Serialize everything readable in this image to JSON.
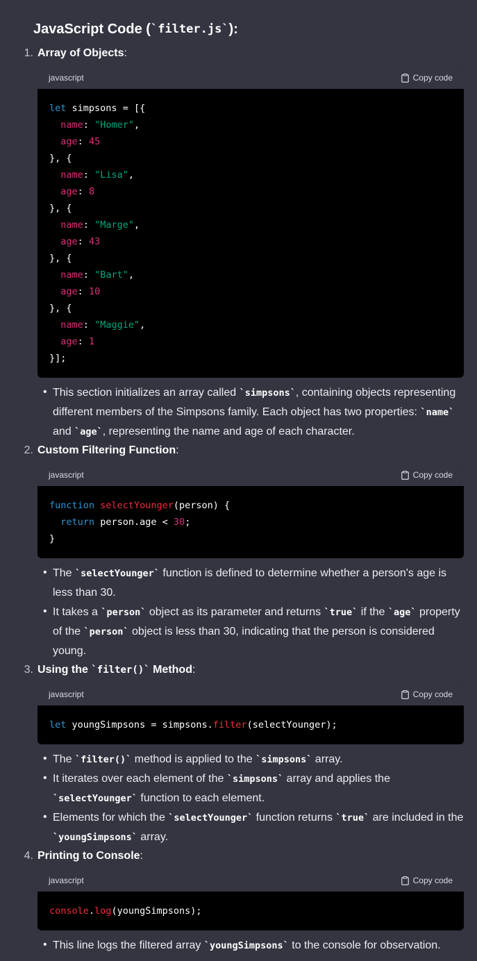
{
  "heading": {
    "prefix": "JavaScript Code (",
    "code": "`filter.js`",
    "suffix": "):"
  },
  "copy_label": "Copy code",
  "lang": "javascript",
  "sections": [
    {
      "num": "1.",
      "title": "Array of Objects",
      "suffix": ":"
    },
    {
      "num": "2.",
      "title": "Custom Filtering Function",
      "suffix": ":"
    },
    {
      "num": "3.",
      "title_pre": "Using the ",
      "title_code": "`filter()`",
      "title_post": " Method",
      "suffix": ":"
    },
    {
      "num": "4.",
      "title": "Printing to Console",
      "suffix": ":"
    }
  ],
  "code1": [
    "let simpsons = [{",
    "  name: \"Homer\",",
    "  age: 45",
    "}, {",
    "  name: \"Lisa\",",
    "  age: 8",
    "}, {",
    "  name: \"Marge\",",
    "  age: 43",
    "}, {",
    "  name: \"Bart\",",
    "  age: 10",
    "}, {",
    "  name: \"Maggie\",",
    "  age: 1",
    "}];"
  ],
  "code2": [
    "function selectYounger(person) {",
    "  return person.age < 30;",
    "}"
  ],
  "code3": [
    "let youngSimpsons = simpsons.filter(selectYounger);"
  ],
  "code4": [
    "console.log(youngSimpsons);"
  ],
  "bullets": {
    "s1": [
      [
        "This section initializes an array called ",
        {
          "c": "`simpsons`"
        },
        ", containing objects representing different members of the Simpsons family. Each object has two properties: ",
        {
          "c": "`name`"
        },
        " and ",
        {
          "c": "`age`"
        },
        ", representing the name and age of each character."
      ]
    ],
    "s2": [
      [
        "The ",
        {
          "c": "`selectYounger`"
        },
        " function is defined to determine whether a person's age is less than 30."
      ],
      [
        "It takes a ",
        {
          "c": "`person`"
        },
        " object as its parameter and returns ",
        {
          "c": "`true`"
        },
        " if the ",
        {
          "c": "`age`"
        },
        " property of the ",
        {
          "c": "`person`"
        },
        " object is less than 30, indicating that the person is considered young."
      ]
    ],
    "s3": [
      [
        "The ",
        {
          "c": "`filter()`"
        },
        " method is applied to the ",
        {
          "c": "`simpsons`"
        },
        " array."
      ],
      [
        "It iterates over each element of the ",
        {
          "c": "`simpsons`"
        },
        " array and applies the ",
        {
          "c": "`selectYounger`"
        },
        " function to each element."
      ],
      [
        "Elements for which the ",
        {
          "c": "`selectYounger`"
        },
        " function returns ",
        {
          "c": "`true`"
        },
        " are included in the ",
        {
          "c": "`youngSimpsons`"
        },
        " array."
      ]
    ],
    "s4": [
      [
        "This line logs the filtered array ",
        {
          "c": "`youngSimpsons`"
        },
        " to the console for observation."
      ]
    ]
  }
}
